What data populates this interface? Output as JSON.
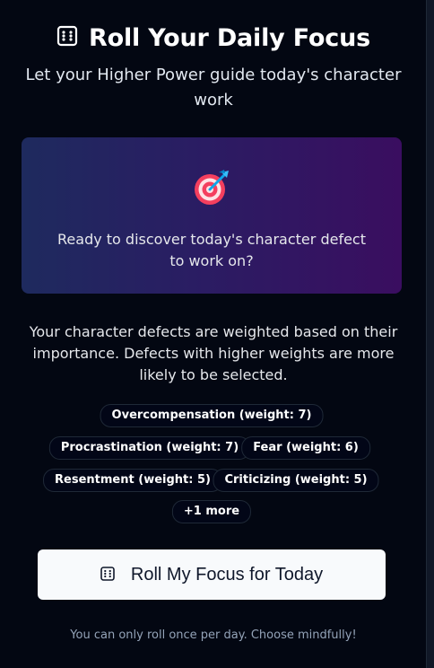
{
  "header": {
    "title": "Roll Your Daily Focus",
    "subtitle": "Let your Higher Power guide today's character work"
  },
  "hero": {
    "icon": "target-icon",
    "prompt": "Ready to discover today's character defect to work on?"
  },
  "note": "Your character defects are weighted based on their importance. Defects with higher weights are more likely to be selected.",
  "defects": [
    "Overcompensation (weight: 7)",
    "Procrastination (weight: 7)",
    "Fear (weight: 6)",
    "Resentment (weight: 5)",
    "Criticizing (weight: 5)"
  ],
  "more_label": "+1 more",
  "roll_button": {
    "label": "Roll My Focus for Today",
    "icon": "dice-icon"
  },
  "footer": "You can only roll once per day. Choose mindfully!",
  "colors": {
    "background": "#030712",
    "hero_gradient_start": "#1e2a5e",
    "hero_gradient_end": "#3a0e60",
    "button_bg": "#f8fafc",
    "button_text": "#0f172a"
  }
}
